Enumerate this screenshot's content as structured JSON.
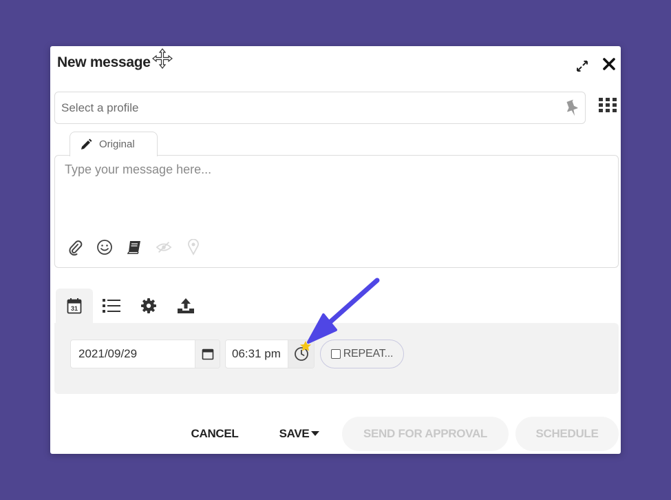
{
  "dialog": {
    "title": "New message"
  },
  "profile": {
    "placeholder": "Select a profile"
  },
  "editor": {
    "tab_label": "Original",
    "message_placeholder": "Type your message here...",
    "tools": [
      "paperclip-icon",
      "smiley-icon",
      "book-icon",
      "eye-slash-icon",
      "location-pin-icon"
    ]
  },
  "options_tabs": [
    "calendar-icon",
    "list-icon",
    "gear-icon",
    "upload-icon"
  ],
  "schedule": {
    "date_value": "2021/09/29",
    "time_value": "06:31 pm",
    "repeat_label": "REPEAT..."
  },
  "footer": {
    "cancel_label": "CANCEL",
    "save_label": "SAVE",
    "approval_label": "SEND FOR APPROVAL",
    "schedule_label": "SCHEDULE"
  },
  "colors": {
    "background": "#4f4590",
    "annotation_arrow": "#4f46e5",
    "annotation_star": "#f5c518"
  }
}
